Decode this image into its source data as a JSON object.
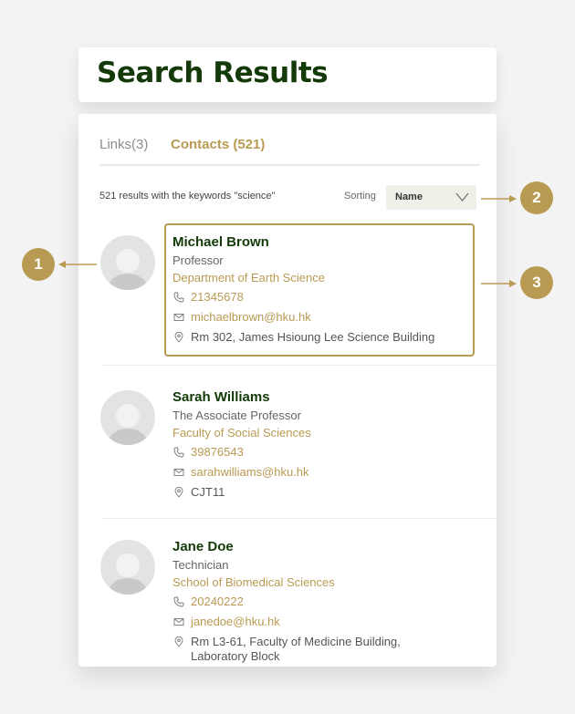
{
  "page": {
    "title": "Search Results"
  },
  "tabs": [
    {
      "label": "Links(3)",
      "active": false
    },
    {
      "label": "Contacts (521)",
      "active": true
    }
  ],
  "results": {
    "summary": "521 results with the keywords \"science\"",
    "sort_label": "Sorting",
    "sort_value": "Name"
  },
  "contacts": [
    {
      "name": "Michael Brown",
      "position": "Professor",
      "department": "Department of Earth Science",
      "phone": "21345678",
      "email": "michaelbrown@hku.hk",
      "address": "Rm 302, James Hsioung Lee Science Building",
      "selected": true
    },
    {
      "name": "Sarah Williams",
      "position": "The Associate Professor",
      "department": "Faculty of Social Sciences",
      "phone": "39876543",
      "email": "sarahwilliams@hku.hk",
      "address": "CJT11",
      "selected": false
    },
    {
      "name": "Jane Doe",
      "position": "Technician",
      "department": "School of Biomedical Sciences",
      "phone": "20240222",
      "email": "janedoe@hku.hk",
      "address": "Rm L3-61, Faculty of Medicine Building, Laboratory Block",
      "selected": false
    }
  ],
  "annotations": [
    {
      "label": "1",
      "points_to": "avatar"
    },
    {
      "label": "2",
      "points_to": "sorting"
    },
    {
      "label": "3",
      "points_to": "contact-card"
    }
  ],
  "colors": {
    "accent": "#b99a52",
    "title_green": "#133a08",
    "background": "#f3f3f3",
    "sort_bg": "#edf1e8"
  },
  "icons": {
    "phone": "phone-icon",
    "email": "mail-icon",
    "address": "location-pin-icon",
    "sort": "chevron-down-icon",
    "avatar": "user-placeholder-icon"
  }
}
